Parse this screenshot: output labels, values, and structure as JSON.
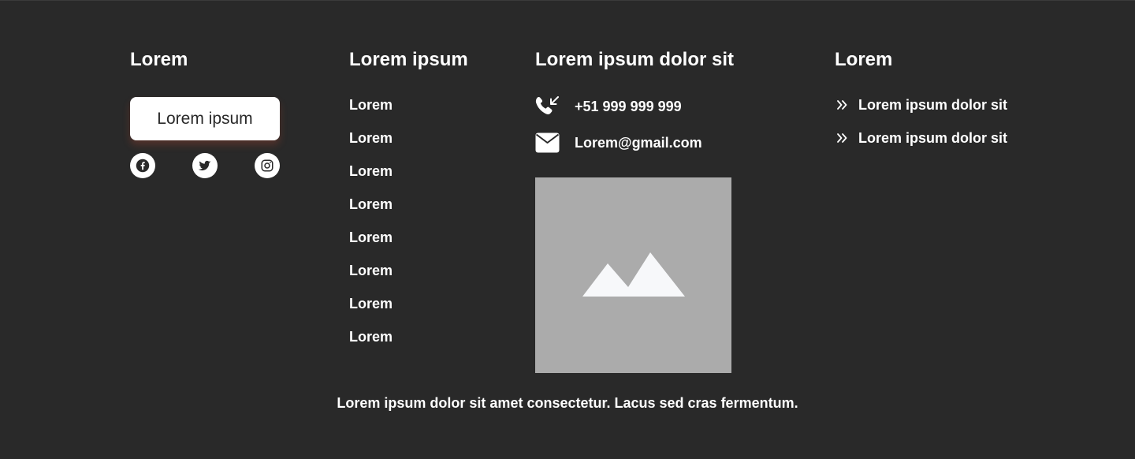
{
  "footer": {
    "col1": {
      "title": "Lorem",
      "button_label": "Lorem ipsum",
      "social": [
        "facebook-icon",
        "twitter-icon",
        "instagram-icon"
      ]
    },
    "col2": {
      "title": "Lorem ipsum",
      "links": [
        "Lorem",
        "Lorem",
        "Lorem",
        "Lorem",
        "Lorem",
        "Lorem",
        "Lorem",
        "Lorem"
      ]
    },
    "col3": {
      "title": "Lorem ipsum dolor sit",
      "phone": "+51 999 999 999",
      "email": "Lorem@gmail.com",
      "image_icon": "image-placeholder-icon"
    },
    "col4": {
      "title": "Lorem",
      "links": [
        "Lorem ipsum dolor sit",
        "Lorem ipsum dolor sit"
      ]
    },
    "bottom_text": "Lorem ipsum dolor sit amet consectetur. Lacus sed cras fermentum."
  },
  "colors": {
    "background": "#292929",
    "text": "#ffffff",
    "image_placeholder": "#ababab",
    "button_bg": "#ffffff",
    "button_text": "#292929"
  }
}
